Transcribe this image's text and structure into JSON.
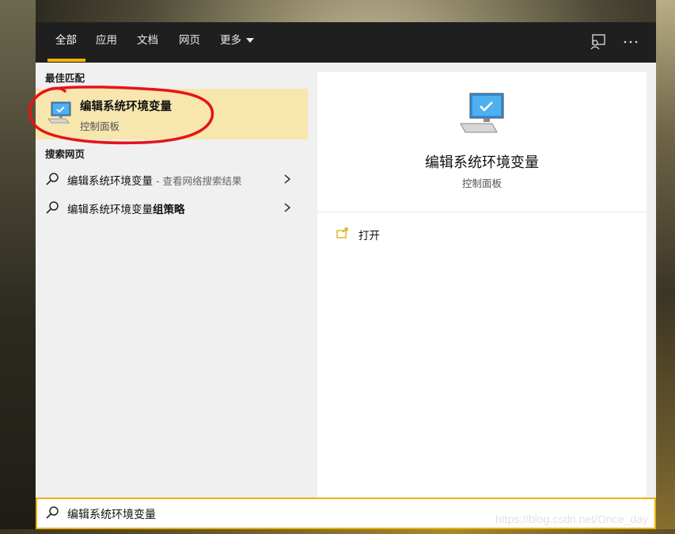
{
  "tabs": [
    {
      "label": "全部",
      "active": true
    },
    {
      "label": "应用"
    },
    {
      "label": "文档"
    },
    {
      "label": "网页"
    },
    {
      "label": "更多"
    }
  ],
  "left": {
    "best_match_title": "最佳匹配",
    "best_match": {
      "title": "编辑系统环境变量",
      "subtitle": "控制面板",
      "icon": "computer-monitor-check-icon"
    },
    "web_title": "搜索网页",
    "web_items": [
      {
        "text": "编辑系统环境变量",
        "hint": " - 查看网络搜索结果"
      },
      {
        "text": "编辑系统环境变量",
        "bold_suffix": "组策略"
      }
    ]
  },
  "right": {
    "title": "编辑系统环境变量",
    "subtitle": "控制面板",
    "actions": [
      {
        "label": "打开",
        "icon": "open-icon"
      }
    ]
  },
  "search": {
    "value": "编辑系统环境变量"
  },
  "watermark": "https://blog.csdn.net/Once_day",
  "colors": {
    "accent": "#f0b400",
    "selected_bg": "#f7e6ad",
    "topbar": "#1f1f1f",
    "annotation": "#e4141a"
  }
}
